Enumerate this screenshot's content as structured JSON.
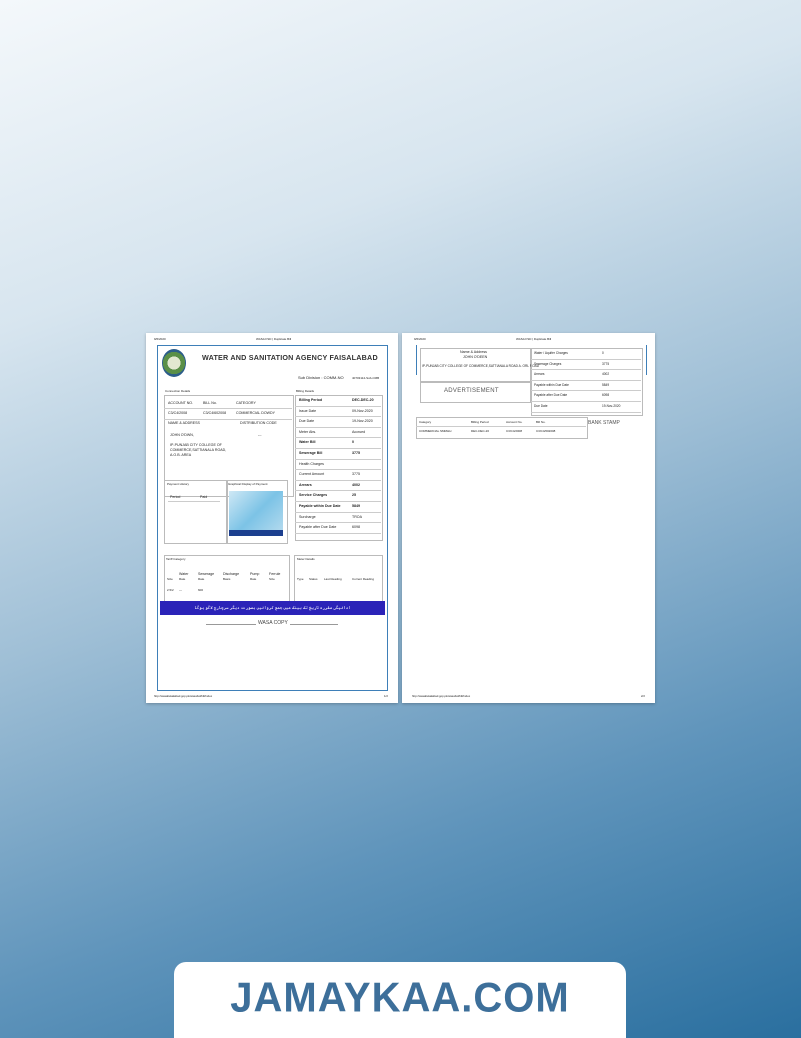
{
  "page1": {
    "hdr_left": "9/6/2020",
    "hdr_center": "WASA FSD | Duplicate Bill",
    "title": "WATER AND SANITATION AGENCY FAISALABAD",
    "sub_division": "Sub Division : COMM-NO",
    "sub_code": "40703112-Sub-CMB",
    "connection_title": "Connection Details",
    "billing_title": "Billing Details",
    "conn_headers": [
      "ACCOUNT NO.",
      "BILL No.",
      "CATEGORY"
    ],
    "conn_values": [
      "C3/C4/2008",
      "C3/C4/602008",
      "COMMERCIAL DOWDY"
    ],
    "name_address_label": "NAME & ADDRESS",
    "distribution_code_label": "DISTRIBUTION CODE",
    "name_value": "JOHN O'DWN,",
    "distribution_code_value": "---",
    "address_lines": [
      "IP-PUNJAB CITY COLLEGE OF",
      "COMMERCE,SATTIANALA ROAD,",
      "A.O.B. AREA"
    ],
    "billing_rows": [
      {
        "label": "Billing Period",
        "value": "DEC-DEC-20",
        "bold": true
      },
      {
        "label": "Issue Date",
        "value": "09-Nov-2020",
        "bold": false
      },
      {
        "label": "Due Date",
        "value": "19-Nov-2020",
        "bold": false
      },
      {
        "label": "Meter Abs.",
        "value": "Accrued",
        "bold": false
      },
      {
        "label": "Water Bill",
        "value": "0",
        "bold": true
      },
      {
        "label": "Sewerage Bill",
        "value": "3775",
        "bold": true
      },
      {
        "label": "Health Charges",
        "value": "",
        "bold": false
      },
      {
        "label": "Current Amount",
        "value": "3775",
        "bold": false
      },
      {
        "label": "Arrears",
        "value": "4002",
        "bold": true
      },
      {
        "label": "Service Charges",
        "value": "25",
        "bold": true
      },
      {
        "label": "Payable within Due Date",
        "value": "5849",
        "bold": true
      },
      {
        "label": "Surcharge",
        "value": "TROA",
        "bold": false
      },
      {
        "label": "Payable after Due Date",
        "value": "6098",
        "bold": false
      }
    ],
    "payment_history_label": "Payment History",
    "graph_label": "Graphical Display of Payment",
    "period_label": "Period",
    "paid_label": "Paid",
    "tariff_title": "Tariff Category",
    "meter_title": "Meter Details",
    "tariff_headers": [
      [
        "",
        "Water"
      ],
      [
        "",
        "Sewerage"
      ],
      [
        "",
        "Discharge"
      ],
      [
        "",
        "Pump"
      ],
      [
        "",
        "Ferrule"
      ]
    ],
    "tariff_sub": [
      "Size",
      "Rate",
      "Rate",
      "Basis",
      "Rate",
      "Size"
    ],
    "tariff_values": [
      "2.5/2",
      "---",
      "600"
    ],
    "meter_headers": [
      "Type",
      "Status",
      "Last Reading",
      "Current Reading"
    ],
    "urdu_notice": "ادائیگی مقررہ تاریخ تک بینک میں جمع کروائیں بصورت دیگر سرچارج لاگو ہوگا",
    "copy_label": "WASA COPY",
    "footer_url": "http://wasafaisalabad.gop.pk/wasafsd/bill/index",
    "footer_page": "1/2"
  },
  "page2": {
    "hdr_left": "9/6/2020",
    "hdr_center": "WASA FSD | Duplicate Bill",
    "name_title": "Name & Address",
    "name_value": "JOHN O'DEEN",
    "address": "IP-PUNJAB CITY COLLEGE OF COMMERCE,SATTIANALA ROAD A. ORL ROAD",
    "advertisement": "ADVERTISEMENT",
    "right_rows": [
      {
        "label": "Water / Aquifer Charges",
        "value": "0"
      },
      {
        "label": "Sewerage Charges",
        "value": "3775"
      },
      {
        "label": "Arrears",
        "value": "4002"
      },
      {
        "label": "Payable within Due Date",
        "value": "5849"
      },
      {
        "label": "Payable after Due Date",
        "value": "6098"
      },
      {
        "label": "Due Date",
        "value": "19-Nov-2020"
      }
    ],
    "stub_headers": [
      "Category",
      "Billing Period",
      "Account No.",
      "Bill No."
    ],
    "stub_values": [
      "COMMERCIAL SMMHH",
      "DEC-DEC-20",
      "C3/C4/2008",
      "C3/C4/602008"
    ],
    "bank_stamp": "BANK STAMP",
    "footer_url": "http://wasafaisalabad.gop.pk/wasafsd/bill/index",
    "footer_page": "2/2"
  },
  "brand": "JAMAYKAA.COM"
}
